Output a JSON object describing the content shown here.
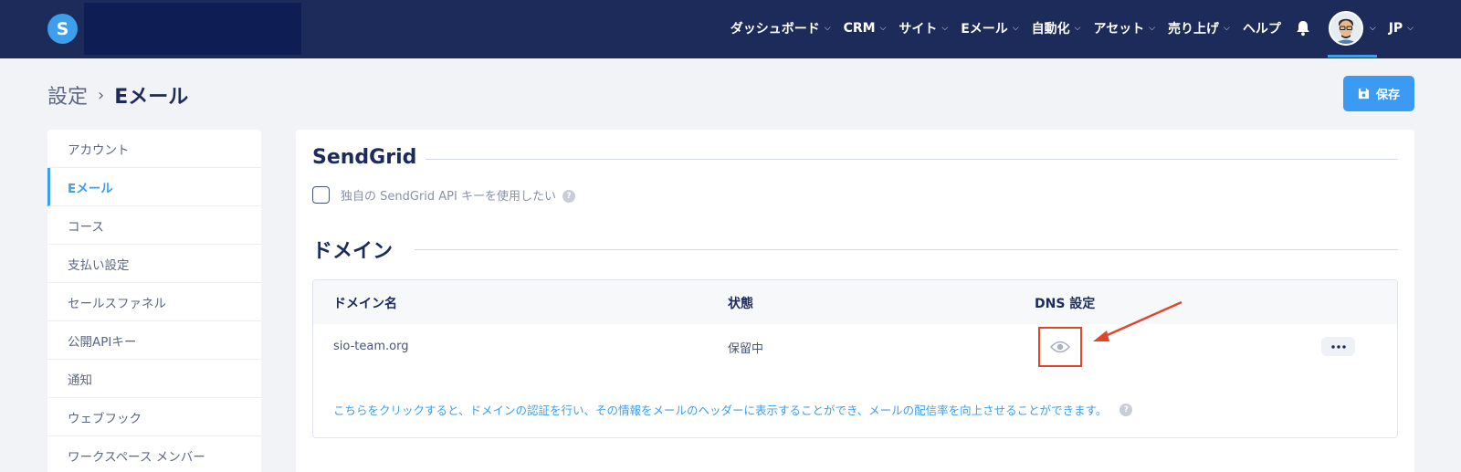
{
  "brand": {
    "logo_letter": "S",
    "accent": "#3d9eec",
    "nav_bg": "#1d2b5a"
  },
  "nav": {
    "items": [
      {
        "label": "ダッシュボード"
      },
      {
        "label": "CRM"
      },
      {
        "label": "サイト"
      },
      {
        "label": "Eメール"
      },
      {
        "label": "自動化"
      },
      {
        "label": "アセット"
      },
      {
        "label": "売り上げ"
      }
    ],
    "help_label": "ヘルプ",
    "bell_icon": "bell-icon",
    "language": "JP"
  },
  "breadcrumb": {
    "parent": "設定",
    "separator": "›",
    "current": "Eメール"
  },
  "save_button": {
    "label": "保存",
    "icon": "floppy-disk-icon"
  },
  "sidebar": {
    "items": [
      {
        "label": "アカウント"
      },
      {
        "label": "Eメール",
        "active": true
      },
      {
        "label": "コース"
      },
      {
        "label": "支払い設定"
      },
      {
        "label": "セールスファネル"
      },
      {
        "label": "公開APIキー"
      },
      {
        "label": "通知"
      },
      {
        "label": "ウェブフック"
      },
      {
        "label": "ワークスペース メンバー"
      }
    ]
  },
  "sendgrid": {
    "title": "SendGrid",
    "checkbox_label": "独自の SendGrid API キーを使用したい",
    "checked": false,
    "help_mark": "?"
  },
  "domain": {
    "title": "ドメイン",
    "columns": [
      "ドメイン名",
      "状態",
      "DNS 設定"
    ],
    "rows": [
      {
        "name": "sio-team.org",
        "status": "保留中",
        "dns_icon": "eye-icon",
        "actions_icon": "more-horizontal-icon"
      }
    ],
    "info_text": "こちらをクリックすると、ドメインの認証を行い、その情報をメールのヘッダーに表示することができ、メールの配信率を向上させることができます。",
    "help_mark": "?"
  },
  "annotation": {
    "color": "#e3452a"
  }
}
